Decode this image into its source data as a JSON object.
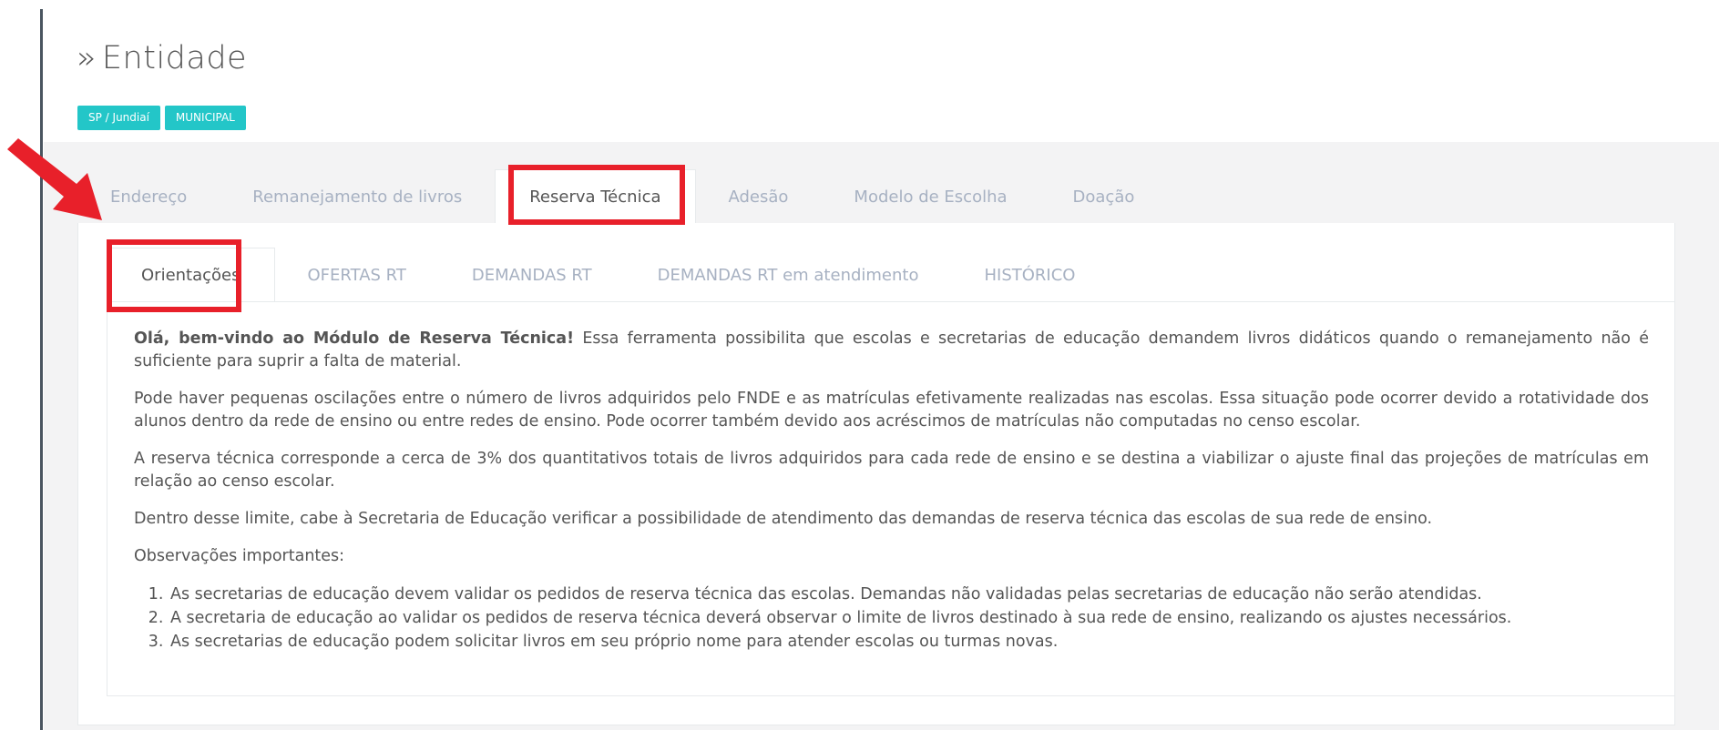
{
  "header": {
    "title_prefix": "»",
    "title": "Entidade",
    "badges": [
      "SP / Jundiaí",
      "MUNICIPAL"
    ]
  },
  "outer_tabs": [
    {
      "label": "Endereço",
      "active": false
    },
    {
      "label": "Remanejamento de livros",
      "active": false
    },
    {
      "label": "Reserva Técnica",
      "active": true
    },
    {
      "label": "Adesão",
      "active": false
    },
    {
      "label": "Modelo de Escolha",
      "active": false
    },
    {
      "label": "Doação",
      "active": false
    }
  ],
  "inner_tabs": [
    {
      "label": "Orientações",
      "active": true
    },
    {
      "label": "OFERTAS RT",
      "active": false
    },
    {
      "label": "DEMANDAS RT",
      "active": false
    },
    {
      "label": "DEMANDAS RT em atendimento",
      "active": false
    },
    {
      "label": "HISTÓRICO",
      "active": false
    }
  ],
  "content": {
    "intro_bold": "Olá, bem-vindo ao Módulo de Reserva Técnica!",
    "intro_rest": " Essa ferramenta possibilita que escolas e secretarias de educação demandem livros didáticos quando o remanejamento não é suficiente para suprir a falta de material.",
    "p2": "Pode haver pequenas oscilações entre o número de livros adquiridos pelo FNDE e as matrículas efetivamente realizadas nas escolas. Essa situação pode ocorrer devido a rotatividade dos alunos dentro da rede de ensino ou entre redes de ensino. Pode ocorrer também devido aos acréscimos de matrículas não computadas no censo escolar.",
    "p3": "A reserva técnica corresponde a cerca de 3% dos quantitativos totais de livros adquiridos para cada rede de ensino e se destina a viabilizar o ajuste final das projeções de matrículas em relação ao censo escolar.",
    "p4": "Dentro desse limite, cabe à Secretaria de Educação verificar a possibilidade de atendimento das demandas de reserva técnica das escolas de sua rede de ensino.",
    "p5": "Observações importantes:",
    "list": [
      "As secretarias de educação devem validar os pedidos de reserva técnica das escolas. Demandas não validadas pelas secretarias de educação não serão atendidas.",
      "A secretaria de educação ao validar os pedidos de reserva técnica deverá observar o limite de livros destinado à sua rede de ensino, realizando os ajustes necessários.",
      "As secretarias de educação podem solicitar livros em seu próprio nome para atender escolas ou turmas novas."
    ]
  },
  "colors": {
    "badge": "#23c6c8",
    "highlight": "#e8202a",
    "inactive_tab": "#a7b1c2"
  }
}
